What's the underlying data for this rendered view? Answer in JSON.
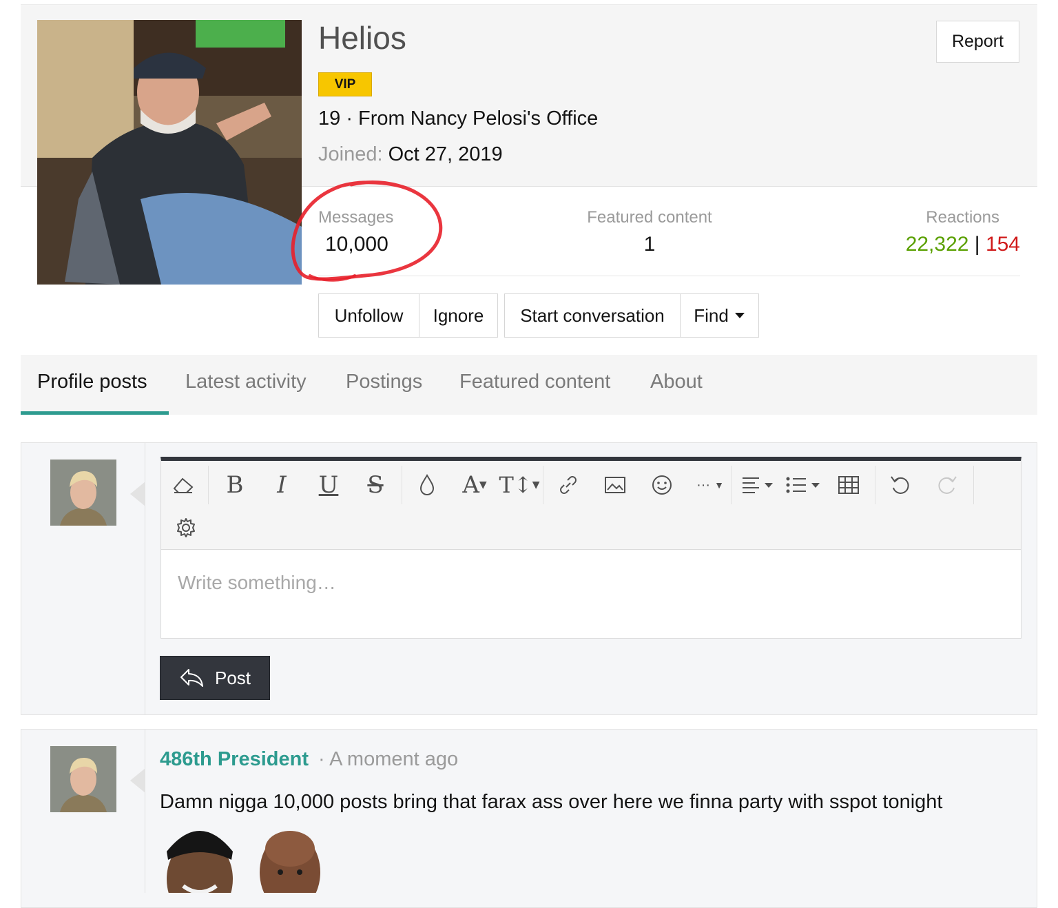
{
  "profile": {
    "username": "Helios",
    "badge": "VIP",
    "meta": "19 · From Nancy Pelosi's Office",
    "joined_label": "Joined:",
    "joined_value": "Oct 27, 2019",
    "report_label": "Report"
  },
  "stats": {
    "messages_label": "Messages",
    "messages_value": "10,000",
    "featured_label": "Featured content",
    "featured_value": "1",
    "reactions_label": "Reactions",
    "reactions_positive": "22,322",
    "reactions_separator": "|",
    "reactions_negative": "154",
    "positive_color": "#5aa000",
    "negative_color": "#d01a1a"
  },
  "actions": {
    "unfollow": "Unfollow",
    "ignore": "Ignore",
    "start_conversation": "Start conversation",
    "find": "Find"
  },
  "tabs": [
    {
      "label": "Profile posts",
      "active": true
    },
    {
      "label": "Latest activity",
      "active": false
    },
    {
      "label": "Postings",
      "active": false
    },
    {
      "label": "Featured content",
      "active": false
    },
    {
      "label": "About",
      "active": false
    }
  ],
  "editor": {
    "placeholder": "Write something…",
    "post_label": "Post",
    "toolbar_icons": [
      "eraser-icon",
      "bold-icon",
      "italic-icon",
      "underline-icon",
      "strikethrough-icon",
      "text-color-icon",
      "font-family-icon",
      "font-size-icon",
      "link-icon",
      "image-icon",
      "smilie-icon",
      "more-options-icon",
      "align-icon",
      "list-icon",
      "table-icon",
      "undo-icon",
      "redo-icon",
      "settings-icon"
    ]
  },
  "comment": {
    "author": "486th President",
    "time": "· A moment ago",
    "text": "Damn nigga 10,000 posts bring that farax ass over here we finna party with sspot tonight"
  },
  "colors": {
    "accent": "#2d9b8f",
    "vip": "#f7c600",
    "annotation": "#e8202a"
  }
}
